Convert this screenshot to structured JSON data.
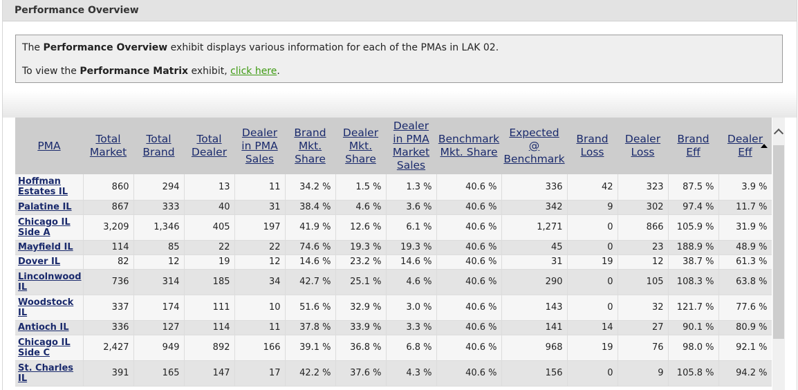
{
  "title": "Performance Overview",
  "info": {
    "line1_prefix": "The ",
    "line1_bold": "Performance Overview",
    "line1_suffix": " exhibit displays various information for each of the PMAs in LAK 02.",
    "line2_prefix": "To view the ",
    "line2_bold": "Performance Matrix",
    "line2_middle": " exhibit, ",
    "line2_link": "click here",
    "line2_suffix": "."
  },
  "table": {
    "columns": [
      [
        "PMA"
      ],
      [
        "Total",
        "Market"
      ],
      [
        "Total",
        "Brand"
      ],
      [
        "Total",
        "Dealer"
      ],
      [
        "Dealer",
        "in PMA",
        "Sales"
      ],
      [
        "Brand",
        "Mkt.",
        "Share"
      ],
      [
        "Dealer",
        "Mkt.",
        "Share"
      ],
      [
        "Dealer",
        "in PMA",
        "Market",
        "Sales"
      ],
      [
        "Benchmark",
        "Mkt. Share"
      ],
      [
        "Expected",
        "@",
        "Benchmark"
      ],
      [
        "Brand",
        "Loss"
      ],
      [
        "Dealer",
        "Loss"
      ],
      [
        "Brand",
        "Eff"
      ],
      [
        "Dealer",
        "Eff"
      ]
    ],
    "rows": [
      [
        "Hoffman Estates IL",
        "860",
        "294",
        "13",
        "11",
        "34.2 %",
        "1.5 %",
        "1.3 %",
        "40.6 %",
        "336",
        "42",
        "323",
        "87.5 %",
        "3.9 %"
      ],
      [
        "Palatine IL",
        "867",
        "333",
        "40",
        "31",
        "38.4 %",
        "4.6 %",
        "3.6 %",
        "40.6 %",
        "342",
        "9",
        "302",
        "97.4 %",
        "11.7 %"
      ],
      [
        "Chicago IL Side A",
        "3,209",
        "1,346",
        "405",
        "197",
        "41.9 %",
        "12.6 %",
        "6.1 %",
        "40.6 %",
        "1,271",
        "0",
        "866",
        "105.9 %",
        "31.9 %"
      ],
      [
        "Mayfield IL",
        "114",
        "85",
        "22",
        "22",
        "74.6 %",
        "19.3 %",
        "19.3 %",
        "40.6 %",
        "45",
        "0",
        "23",
        "188.9 %",
        "48.9 %"
      ],
      [
        "Dover IL",
        "82",
        "12",
        "19",
        "12",
        "14.6 %",
        "23.2 %",
        "14.6 %",
        "40.6 %",
        "31",
        "19",
        "12",
        "38.7 %",
        "61.3 %"
      ],
      [
        "Lincolnwood IL",
        "736",
        "314",
        "185",
        "34",
        "42.7 %",
        "25.1 %",
        "4.6 %",
        "40.6 %",
        "290",
        "0",
        "105",
        "108.3 %",
        "63.8 %"
      ],
      [
        "Woodstock IL",
        "337",
        "174",
        "111",
        "10",
        "51.6 %",
        "32.9 %",
        "3.0 %",
        "40.6 %",
        "143",
        "0",
        "32",
        "121.7 %",
        "77.6 %"
      ],
      [
        "Antioch IL",
        "336",
        "127",
        "114",
        "11",
        "37.8 %",
        "33.9 %",
        "3.3 %",
        "40.6 %",
        "141",
        "14",
        "27",
        "90.1 %",
        "80.9 %"
      ],
      [
        "Chicago IL Side C",
        "2,427",
        "949",
        "892",
        "166",
        "39.1 %",
        "36.8 %",
        "6.8 %",
        "40.6 %",
        "968",
        "19",
        "76",
        "98.0 %",
        "92.1 %"
      ],
      [
        "St. Charles IL",
        "391",
        "165",
        "147",
        "17",
        "42.2 %",
        "37.6 %",
        "4.3 %",
        "40.6 %",
        "156",
        "0",
        "9",
        "105.8 %",
        "94.2 %"
      ]
    ]
  }
}
